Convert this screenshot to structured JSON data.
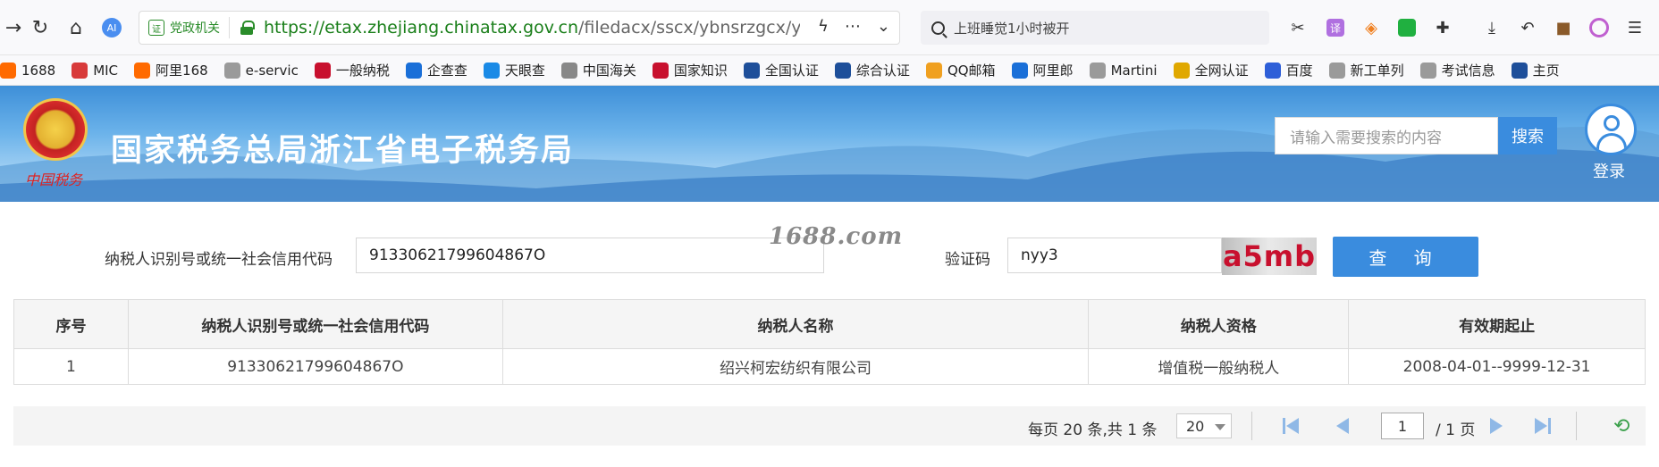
{
  "browser": {
    "security_badge": "党政机关",
    "url_host": "https://etax.zhejiang.chinatax.gov.cn",
    "url_path": "/filedacx/sscx/ybnsrzgcx/ybnsrzgcx",
    "search_text": "上班睡觉1小时被开"
  },
  "bookmarks": [
    {
      "label": "1688",
      "color": "#ff6a00"
    },
    {
      "label": "MIC",
      "color": "#d83a3a"
    },
    {
      "label": "阿里168",
      "color": "#ff6a00"
    },
    {
      "label": "e-servic",
      "color": "#9a9a9a"
    },
    {
      "label": "一般纳税",
      "color": "#c8102e"
    },
    {
      "label": "企查查",
      "color": "#1a6fd8"
    },
    {
      "label": "天眼查",
      "color": "#1a8ae6"
    },
    {
      "label": "中国海关",
      "color": "#888888"
    },
    {
      "label": "国家知识",
      "color": "#c8102e"
    },
    {
      "label": "全国认证",
      "color": "#1e4f9a"
    },
    {
      "label": "综合认证",
      "color": "#1e4f9a"
    },
    {
      "label": "QQ邮箱",
      "color": "#f0a020"
    },
    {
      "label": "阿里郎",
      "color": "#1a6fd8"
    },
    {
      "label": "Martini",
      "color": "#9a9a9a"
    },
    {
      "label": "全网认证",
      "color": "#e0a800"
    },
    {
      "label": "百度",
      "color": "#2e5fd8"
    },
    {
      "label": "新工单列",
      "color": "#9a9a9a"
    },
    {
      "label": "考试信息",
      "color": "#9a9a9a"
    },
    {
      "label": "主页",
      "color": "#1e4f9a"
    }
  ],
  "header": {
    "title": "国家税务总局浙江省电子税务局",
    "emblem_caption": "中国税务",
    "search_placeholder": "请输入需要搜索的内容",
    "search_button": "搜索",
    "login_label": "登录"
  },
  "form": {
    "taxpayer_id_label": "纳税人识别号或统一社会信用代码",
    "taxpayer_id_value": "91330621799604867O",
    "captcha_label": "验证码",
    "captcha_value": "nyy3",
    "captcha_image_text": "a5mb",
    "watermark": "1688.com",
    "query_button": "查 询"
  },
  "table": {
    "headers": [
      "序号",
      "纳税人识别号或统一社会信用代码",
      "纳税人名称",
      "纳税人资格",
      "有效期起止"
    ],
    "rows": [
      [
        "1",
        "91330621799604867O",
        "绍兴柯宏纺织有限公司",
        "增值税一般纳税人",
        "2008-04-01--9999-12-31"
      ]
    ]
  },
  "pager": {
    "summary": "每页 20 条,共 1 条",
    "page_size": "20",
    "current_page": "1",
    "total_pages": "/ 1 页"
  }
}
